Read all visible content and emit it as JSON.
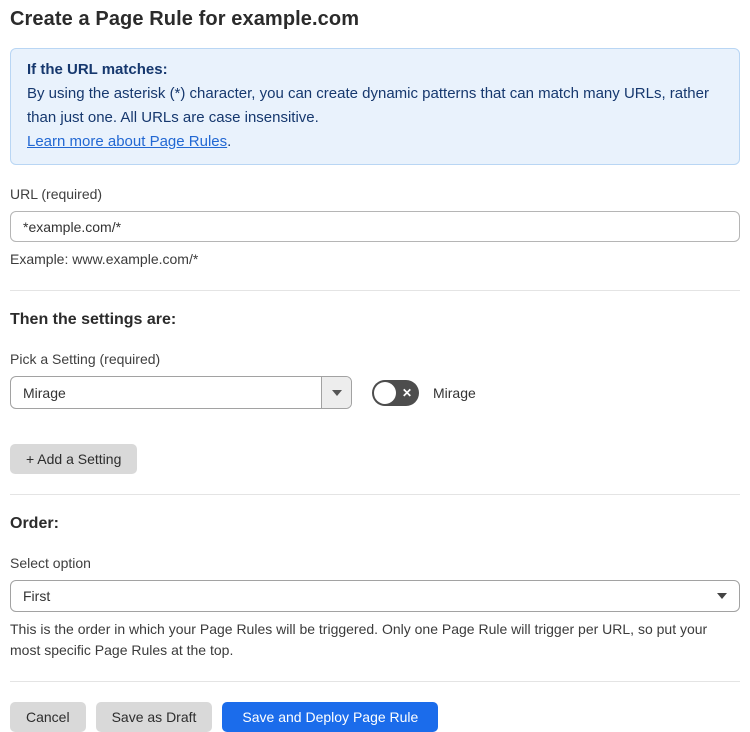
{
  "page": {
    "title": "Create a Page Rule for example.com"
  },
  "info_box": {
    "heading": "If the URL matches:",
    "body": "By using the asterisk (*) character, you can create dynamic patterns that can match many URLs, rather than just one. All URLs are case insensitive.",
    "link_label": "Learn more about Page Rules",
    "link_suffix": "."
  },
  "url_field": {
    "label": "URL (required)",
    "value": "*example.com/*",
    "helper": "Example: www.example.com/*"
  },
  "settings_section": {
    "heading": "Then the settings are:",
    "picker_label": "Pick a Setting (required)",
    "picker_value": "Mirage",
    "toggle_label": "Mirage",
    "toggle_state": "off",
    "add_setting_label": "+ Add a Setting"
  },
  "order_section": {
    "heading": "Order:",
    "select_label": "Select option",
    "select_value": "First",
    "helper": "This is the order in which your Page Rules will be triggered. Only one Page Rule will trigger per URL, so put your most specific Page Rules at the top."
  },
  "actions": {
    "cancel": "Cancel",
    "save_draft": "Save as Draft",
    "save_deploy": "Save and Deploy Page Rule"
  },
  "colors": {
    "accent_blue": "#1b6ceb",
    "info_box_background": "#e9f2fc",
    "info_box_border": "#b9d6f4",
    "info_box_text": "#16386e",
    "link_blue": "#2268d3",
    "toggle_off_gray": "#4d4d4d",
    "button_gray": "#d9d9d9"
  }
}
